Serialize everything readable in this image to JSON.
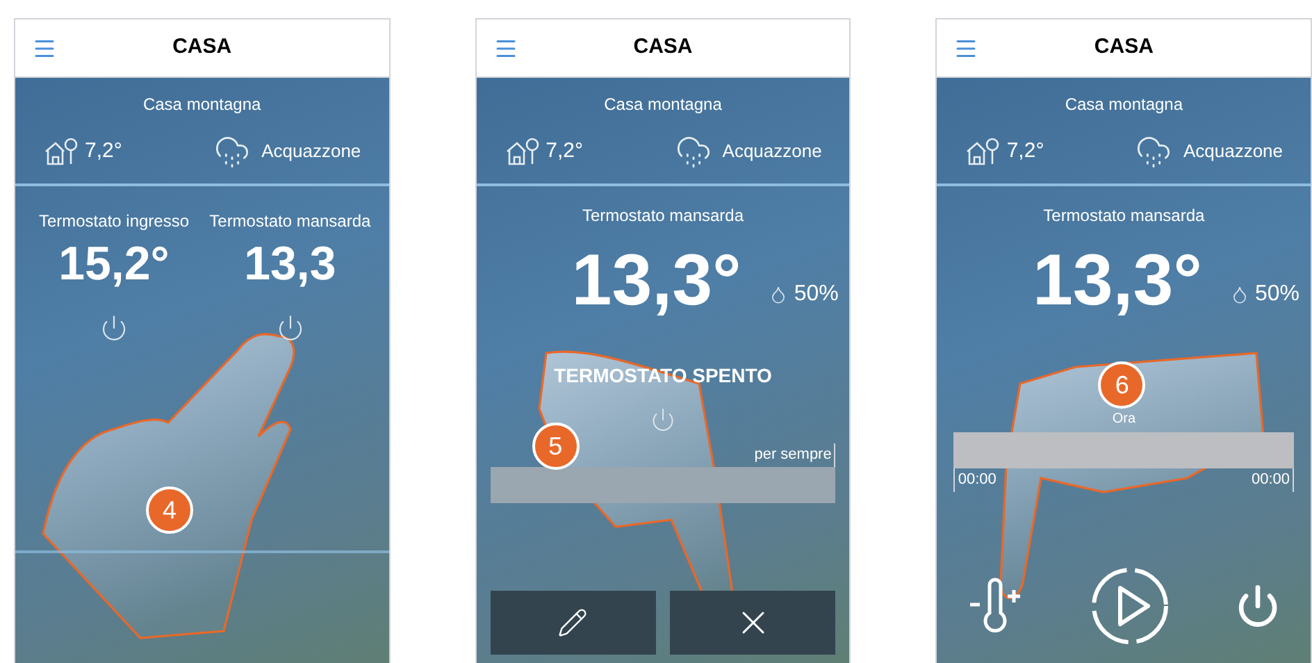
{
  "screens": [
    {
      "kind": "overview",
      "step": "4",
      "title": "CASA",
      "location": "Casa montagna",
      "outdoor_temp": "7,2°",
      "weather": "Acquazzone",
      "thermostats": [
        {
          "name": "Termostato ingresso",
          "temp": "15,2°"
        },
        {
          "name": "Termostato mansarda",
          "temp": "13,3"
        }
      ]
    },
    {
      "kind": "off",
      "step": "5",
      "title": "CASA",
      "location": "Casa montagna",
      "outdoor_temp": "7,2°",
      "weather": "Acquazzone",
      "thermostat": "Termostato mansarda",
      "temp": "13,3°",
      "humidity": "50%",
      "status": "TERMOSTATO SPENTO",
      "duration": "per sempre"
    },
    {
      "kind": "program",
      "step": "6",
      "title": "CASA",
      "location": "Casa montagna",
      "outdoor_temp": "7,2°",
      "weather": "Acquazzone",
      "thermostat": "Termostato mansarda",
      "temp": "13,3°",
      "humidity": "50%",
      "now_label": "Ora",
      "time_start": "00:00",
      "time_end": "00:00"
    }
  ]
}
